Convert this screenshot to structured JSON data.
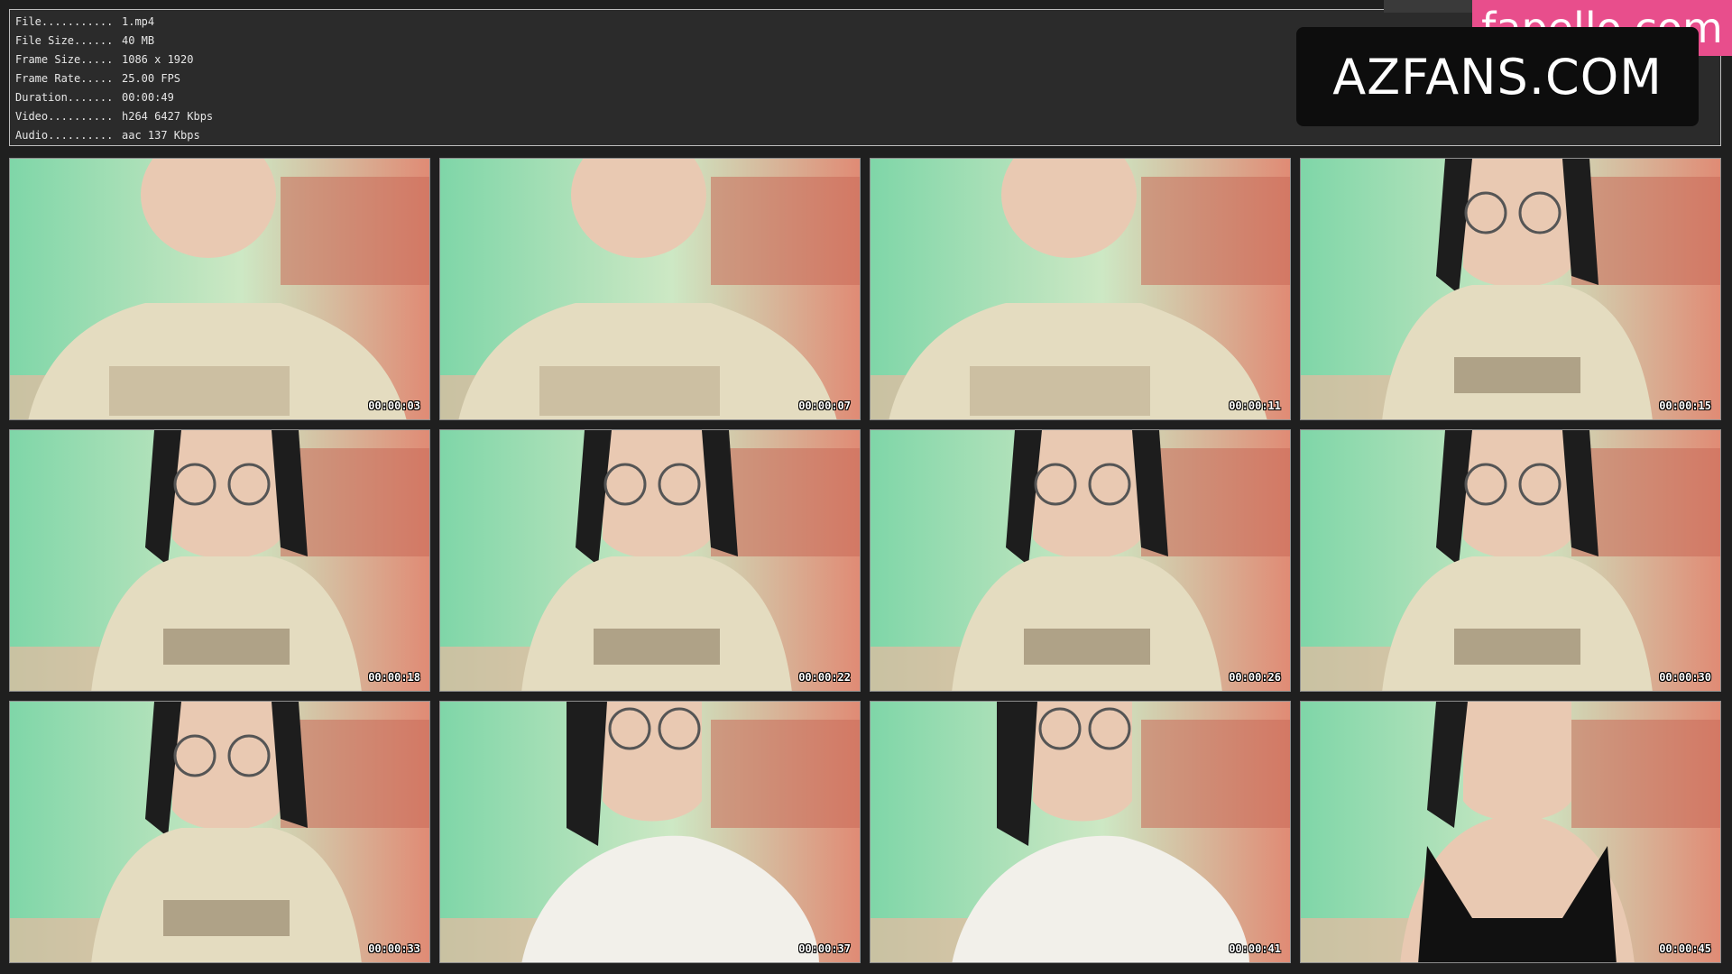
{
  "file_info": [
    {
      "label": "File...........",
      "value": "1.mp4"
    },
    {
      "label": "File Size......",
      "value": "40 MB"
    },
    {
      "label": "Frame Size.....",
      "value": "1086 x 1920"
    },
    {
      "label": "Frame Rate.....",
      "value": "25.00 FPS"
    },
    {
      "label": "Duration.......",
      "value": "00:00:49"
    },
    {
      "label": "Video..........",
      "value": "h264 6427 Kbps"
    },
    {
      "label": "Audio..........",
      "value": "aac 137 Kbps"
    }
  ],
  "watermark": "AZFANS.COM",
  "pink_logo": "fapello.com",
  "thumbnails": [
    {
      "timestamp": "00:00:03",
      "scene": "closeup"
    },
    {
      "timestamp": "00:00:07",
      "scene": "closeup"
    },
    {
      "timestamp": "00:00:11",
      "scene": "closeup"
    },
    {
      "timestamp": "00:00:15",
      "scene": "seated"
    },
    {
      "timestamp": "00:00:18",
      "scene": "seated"
    },
    {
      "timestamp": "00:00:22",
      "scene": "seated"
    },
    {
      "timestamp": "00:00:26",
      "scene": "seated"
    },
    {
      "timestamp": "00:00:30",
      "scene": "seated"
    },
    {
      "timestamp": "00:00:33",
      "scene": "seated"
    },
    {
      "timestamp": "00:00:37",
      "scene": "towel"
    },
    {
      "timestamp": "00:00:41",
      "scene": "towel"
    },
    {
      "timestamp": "00:00:45",
      "scene": "dark-top"
    }
  ],
  "colors": {
    "background": "#1f1f1f",
    "panel": "#2b2b2b",
    "wall_green": "#7fd6a8",
    "wall_red": "#e08a74",
    "shirt": "#e4dcc0",
    "pink_logo": "#e84e8c"
  }
}
